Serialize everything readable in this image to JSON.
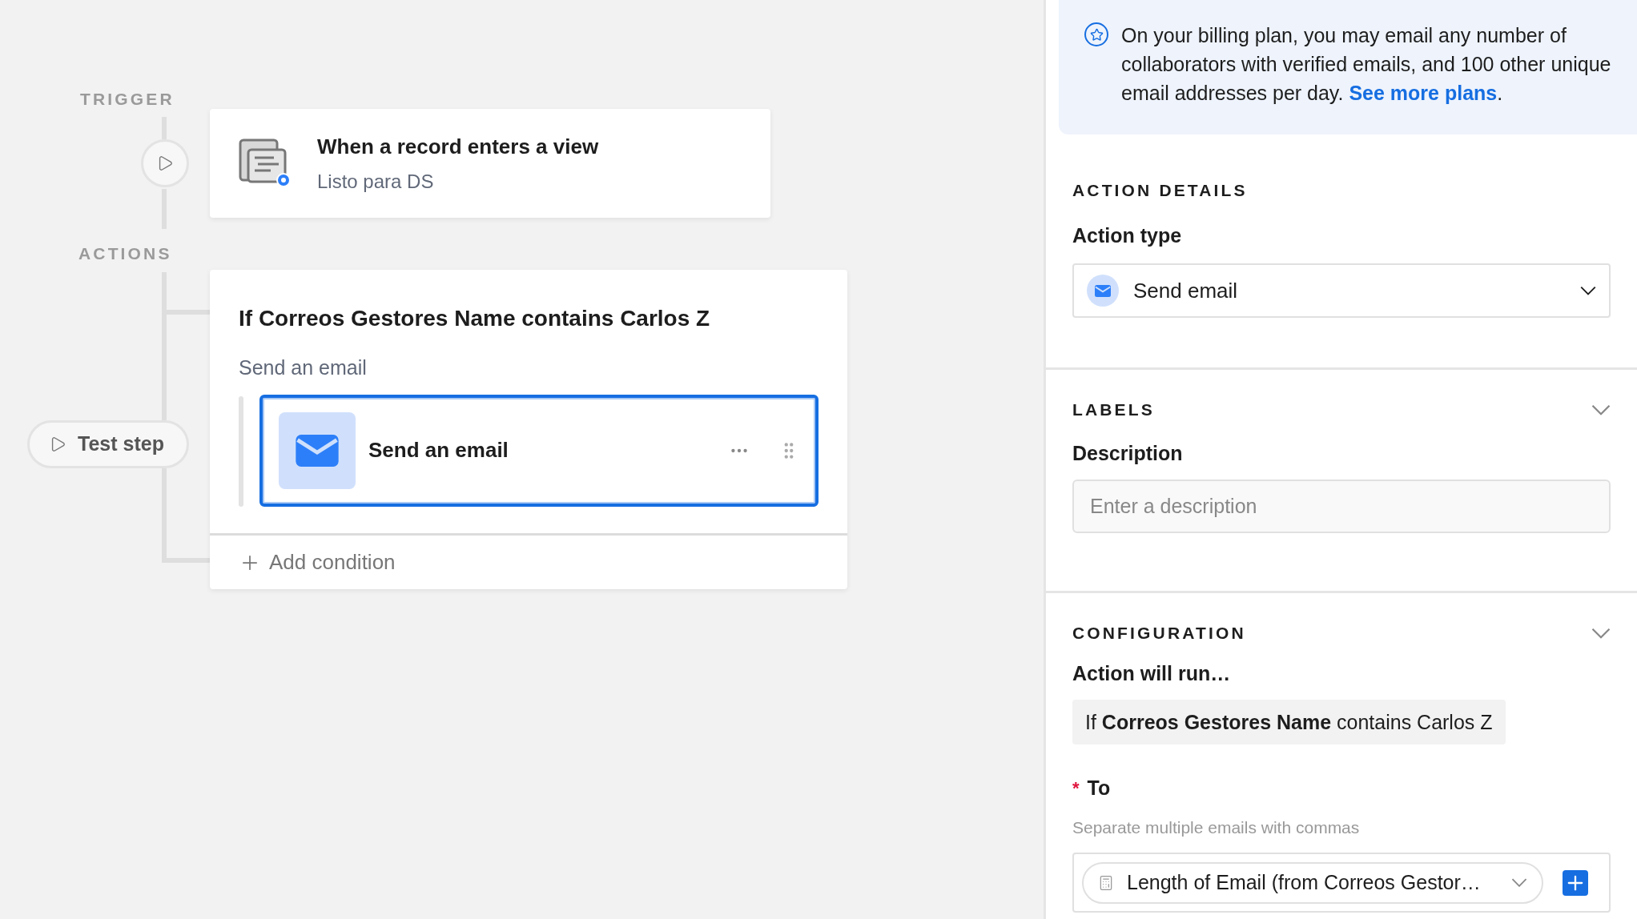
{
  "trigger": {
    "section_label": "TRIGGER",
    "title": "When a record enters a view",
    "subtitle": "Listo para DS"
  },
  "actions": {
    "section_label": "ACTIONS",
    "test_button": "Test step",
    "condition": {
      "title": "If Correos Gestores Name contains Carlos Z",
      "subtitle": "Send an email",
      "steps": [
        {
          "label": "Send an email",
          "selected": true
        }
      ],
      "add_button": "Add condition"
    }
  },
  "panel": {
    "notice": {
      "text": "On your billing plan, you may email any number of collaborators with verified emails, and 100 other unique email addresses per day.",
      "link": "See more plans",
      "suffix": "."
    },
    "action_details": {
      "heading": "ACTION DETAILS",
      "field_label": "Action type",
      "value": "Send email"
    },
    "labels": {
      "heading": "LABELS",
      "expanded": true,
      "field_label": "Description",
      "placeholder": "Enter a description"
    },
    "configuration": {
      "heading": "CONFIGURATION",
      "expanded": true,
      "run_label": "Action will run…",
      "run_condition": "If **Correos Gestores Name** contains Carlos Z",
      "to": {
        "label": "To",
        "required": true,
        "required_mark": "*",
        "hint": "Separate multiple emails with commas",
        "token": "Length of Email (from Correos Gestor…"
      }
    }
  }
}
